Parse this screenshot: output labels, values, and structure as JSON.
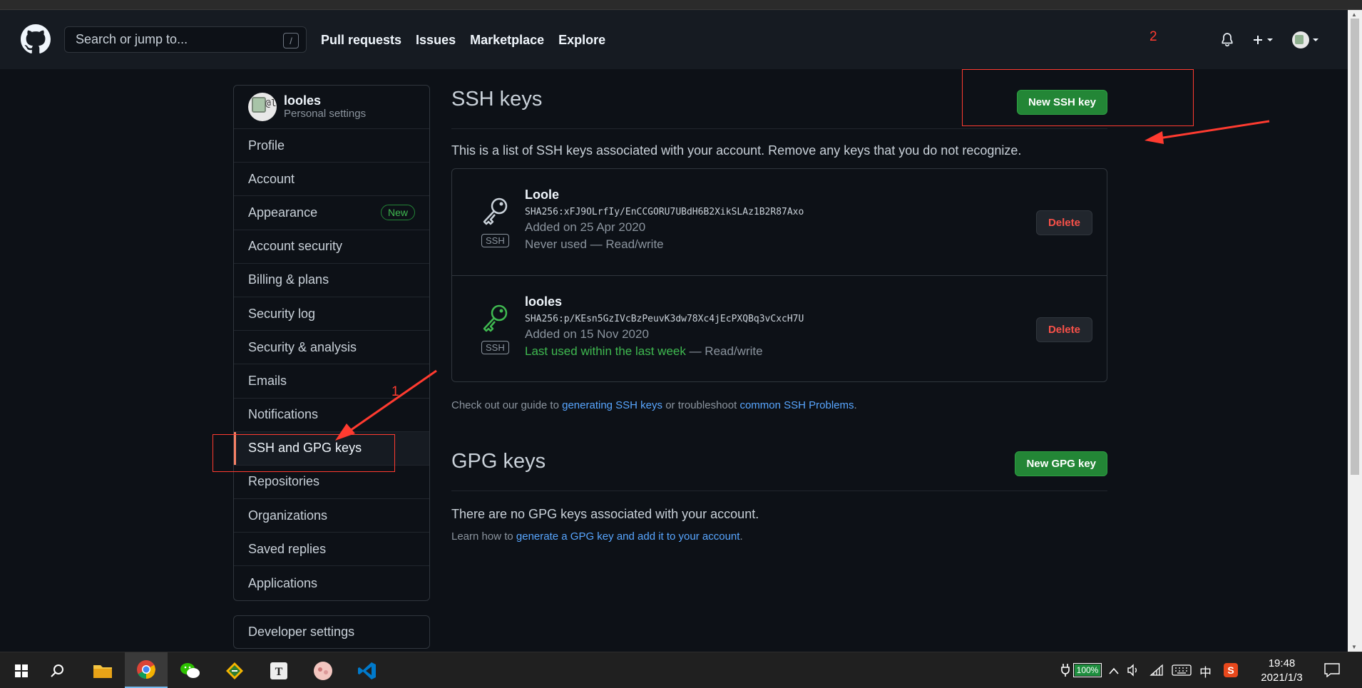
{
  "header": {
    "search_placeholder": "Search or jump to...",
    "search_shortcut": "/",
    "nav": [
      "Pull requests",
      "Issues",
      "Marketplace",
      "Explore"
    ]
  },
  "sidebar": {
    "user": "looles",
    "subtitle": "Personal settings",
    "avatar_text": "@lo",
    "items": [
      {
        "label": "Profile"
      },
      {
        "label": "Account"
      },
      {
        "label": "Appearance",
        "badge": "New"
      },
      {
        "label": "Account security"
      },
      {
        "label": "Billing & plans"
      },
      {
        "label": "Security log"
      },
      {
        "label": "Security & analysis"
      },
      {
        "label": "Emails"
      },
      {
        "label": "Notifications"
      },
      {
        "label": "SSH and GPG keys",
        "selected": true
      },
      {
        "label": "Repositories"
      },
      {
        "label": "Organizations"
      },
      {
        "label": "Saved replies"
      },
      {
        "label": "Applications"
      }
    ],
    "developer_settings": "Developer settings"
  },
  "ssh": {
    "title": "SSH keys",
    "new_button": "New SSH key",
    "intro": "This is a list of SSH keys associated with your account. Remove any keys that you do not recognize.",
    "key_type_label": "SSH",
    "delete_label": "Delete",
    "keys": [
      {
        "name": "Loole",
        "fingerprint": "SHA256:xFJ9OLrfIy/EnCCGORU7UBdH6B2XikSLAz1B2R87Axo",
        "added": "Added on 25 Apr 2020",
        "usage_prefix": "Never used",
        "usage_suffix": " — Read/write"
      },
      {
        "name": "looles",
        "fingerprint": "SHA256:p/KEsn5GzIVcBzPeuvK3dw78Xc4jEcPXQBq3vCxcH7U",
        "added": "Added on 15 Nov 2020",
        "usage_prefix": "Last used within the last week",
        "usage_suffix": " — Read/write"
      }
    ],
    "help_pre": "Check out our guide to ",
    "help_link1": "generating SSH keys",
    "help_mid": " or troubleshoot ",
    "help_link2": "common SSH Problems",
    "help_post": "."
  },
  "gpg": {
    "title": "GPG keys",
    "new_button": "New GPG key",
    "empty": "There are no GPG keys associated with your account.",
    "learn_pre": "Learn how to ",
    "learn_link": "generate a GPG key and add it to your account",
    "learn_post": "."
  },
  "annotations": {
    "step1": "1",
    "step2": "2"
  },
  "taskbar": {
    "battery": "100%",
    "ime": "中",
    "time": "19:48",
    "date": "2021/1/3"
  },
  "colors": {
    "accent_green": "#238636",
    "link_blue": "#58a6ff",
    "danger_red": "#f85149",
    "annotation_red": "#ff3b30",
    "selected_bar": "#f78166"
  }
}
